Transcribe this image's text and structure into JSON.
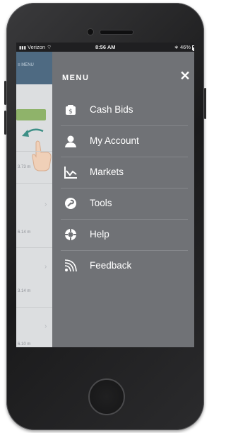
{
  "status_bar": {
    "carrier": "Verizon",
    "time": "8:56 AM",
    "battery": "46%",
    "battery_level": 0.46
  },
  "underlay": {
    "header_label": "MENU",
    "distances": [
      "3.73 m",
      "6.14 m",
      "3.14 m",
      "6.10 m"
    ]
  },
  "menu": {
    "title": "MENU",
    "close_label": "✕",
    "items": [
      {
        "label": "Cash Bids",
        "icon": "dollar-icon"
      },
      {
        "label": "My Account",
        "icon": "user-icon"
      },
      {
        "label": "Markets",
        "icon": "chart-icon"
      },
      {
        "label": "Tools",
        "icon": "tools-icon"
      },
      {
        "label": "Help",
        "icon": "help-icon"
      },
      {
        "label": "Feedback",
        "icon": "wifi-feed-icon"
      }
    ]
  },
  "colors": {
    "menu_background": "#707276",
    "accent_green": "#8fb36a",
    "header_blue": "#4e6a82",
    "arrow_teal": "#3d8f86"
  }
}
